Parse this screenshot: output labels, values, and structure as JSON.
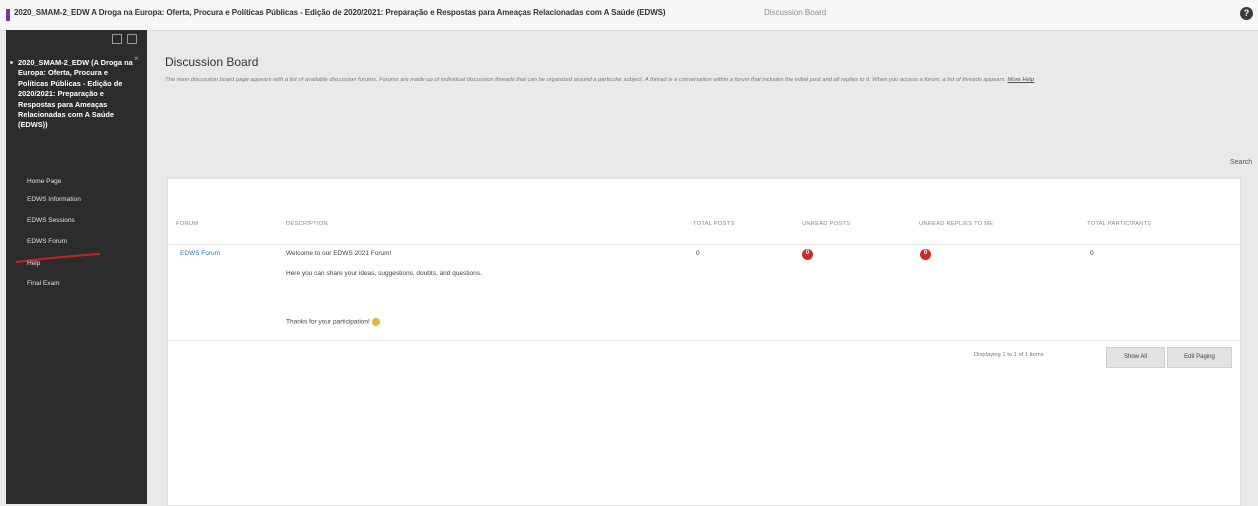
{
  "topbar": {
    "breadcrumb": "2020_SMAM-2_EDW A Droga na Europa: Oferta, Procura e Políticas Públicas - Edição de 2020/2021: Preparação e Respostas para Ameaças Relacionadas com A Saúde (EDWS)",
    "breadcrumb_current": "Discussion Board",
    "help_icon": "?"
  },
  "sidebar": {
    "course_title": "2020_SMAM-2_EDW (A Droga na Europa: Oferta, Procura e Políticas Públicas - Edição de 2020/2021: Preparação e Respostas para Ameaças Relacionadas com A Saúde (EDWS))",
    "items": [
      {
        "label": "Home Page"
      },
      {
        "label": "EDWS Information"
      },
      {
        "label": "EDWS Sessions"
      },
      {
        "label": "EDWS Forum"
      },
      {
        "label": "Help"
      },
      {
        "label": "Final Exam"
      }
    ],
    "highlight_color": "#d01f1f"
  },
  "main": {
    "title": "Discussion Board",
    "intro": "The main discussion board page appears with a list of available discussion forums. Forums are made up of individual discussion threads that can be organized around a particular subject. A thread is a conversation within a forum that includes the initial post and all replies to it. When you access a forum, a list of threads appears.",
    "more_help": "More Help",
    "search_label": "Search"
  },
  "table": {
    "headers": {
      "forum": "FORUM",
      "description": "DESCRIPTION",
      "total_posts": "TOTAL POSTS",
      "unread_posts": "UNREAD POSTS",
      "unread_replies": "UNREAD REPLIES TO ME",
      "total_participants": "TOTAL PARTICIPANTS"
    },
    "row": {
      "forum": "EDWS Forum",
      "desc_line1": "Welcome to our EDWS 2021 Forum!",
      "desc_line2": "Here you can share your ideas, suggestions, doubts, and questions.",
      "desc_line3": "Thanks for your participation!",
      "total_posts": "0",
      "unread_posts": "0",
      "unread_replies": "0",
      "total_participants": "0"
    },
    "badge_color": "#cf2a27"
  },
  "pagination": {
    "display_text": "Displaying 1 to 1 of 1 items",
    "show_all": "Show All",
    "edit_paging": "Edit Paging"
  }
}
